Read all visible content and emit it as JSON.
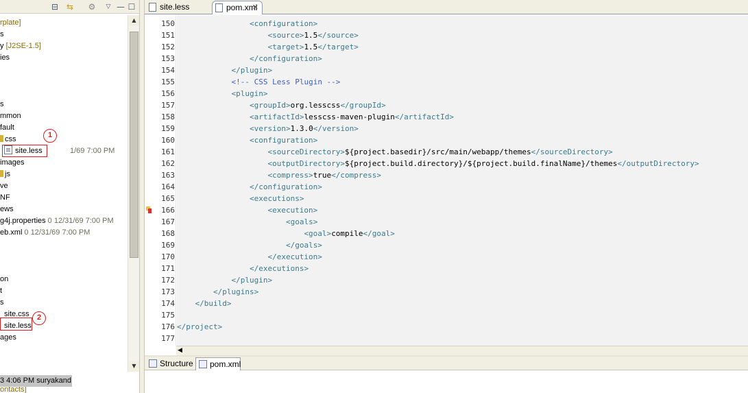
{
  "left_panel": {
    "tree_rows": [
      {
        "text": "rplate]",
        "style": "ann",
        "y": 0
      },
      {
        "text": "s",
        "style": "plain"
      },
      {
        "text": "y ",
        "style": "plain",
        "extra": "[J2SE-1.5]"
      },
      {
        "text": "ies",
        "style": "plain"
      },
      {
        "text": "",
        "style": "plain"
      },
      {
        "text": "",
        "style": "plain"
      },
      {
        "text": "",
        "style": "plain"
      },
      {
        "text": "s",
        "style": "plain"
      },
      {
        "text": "mmon",
        "style": "plain"
      },
      {
        "text": "fault",
        "style": "plain"
      },
      {
        "text": "css",
        "style": "folder"
      },
      {
        "text": "site.less",
        "style": "file",
        "time": "1/69 7:00 PM"
      },
      {
        "text": "images",
        "style": "plain"
      },
      {
        "text": "js",
        "style": "folder"
      },
      {
        "text": "ve",
        "style": "plain"
      },
      {
        "text": "NF",
        "style": "plain"
      },
      {
        "text": "ews",
        "style": "plain"
      },
      {
        "text": "g4j.properties",
        "style": "plain",
        "time": "0  12/31/69 7:00 PM"
      },
      {
        "text": "eb.xml",
        "style": "plain",
        "time": "0  12/31/69 7:00 PM"
      },
      {
        "text": "",
        "style": "plain"
      },
      {
        "text": "",
        "style": "plain"
      },
      {
        "text": "",
        "style": "plain"
      },
      {
        "text": "on",
        "style": "plain"
      },
      {
        "text": "t",
        "style": "plain"
      },
      {
        "text": "s",
        "style": "plain"
      },
      {
        "text": "site.css",
        "style": "plain"
      },
      {
        "text": "site.less",
        "style": "plain"
      },
      {
        "text": "ages",
        "style": "plain"
      }
    ],
    "callouts": [
      "1",
      "2"
    ],
    "status_row": "3 4:06 PM  suryakand",
    "bottom_cut": "ontacts]"
  },
  "editor": {
    "tabs": [
      {
        "label": "site.less",
        "active": false
      },
      {
        "label": "pom.xml",
        "active": true,
        "close": "✕"
      }
    ],
    "lines": [
      {
        "n": "150",
        "indent": 16,
        "parts": [
          [
            "tag",
            "<configuration>"
          ]
        ]
      },
      {
        "n": "151",
        "indent": 20,
        "parts": [
          [
            "tag",
            "<source>"
          ],
          [
            "txt",
            "1.5"
          ],
          [
            "tag",
            "</source>"
          ]
        ]
      },
      {
        "n": "152",
        "indent": 20,
        "parts": [
          [
            "tag",
            "<target>"
          ],
          [
            "txt",
            "1.5"
          ],
          [
            "tag",
            "</target>"
          ]
        ]
      },
      {
        "n": "153",
        "indent": 16,
        "parts": [
          [
            "tag",
            "</configuration>"
          ]
        ]
      },
      {
        "n": "154",
        "indent": 12,
        "parts": [
          [
            "tag",
            "</plugin>"
          ]
        ]
      },
      {
        "n": "155",
        "indent": 12,
        "parts": [
          [
            "cmt",
            "<!-- CSS Less Plugin -->"
          ]
        ]
      },
      {
        "n": "156",
        "indent": 12,
        "parts": [
          [
            "tag",
            "<plugin>"
          ]
        ]
      },
      {
        "n": "157",
        "indent": 16,
        "parts": [
          [
            "tag",
            "<groupId>"
          ],
          [
            "txt",
            "org.lesscss"
          ],
          [
            "tag",
            "</groupId>"
          ]
        ]
      },
      {
        "n": "158",
        "indent": 16,
        "parts": [
          [
            "tag",
            "<artifactId>"
          ],
          [
            "txt",
            "lesscss-maven-plugin"
          ],
          [
            "tag",
            "</artifactId>"
          ]
        ]
      },
      {
        "n": "159",
        "indent": 16,
        "parts": [
          [
            "tag",
            "<version>"
          ],
          [
            "txt",
            "1.3.0"
          ],
          [
            "tag",
            "</version>"
          ]
        ]
      },
      {
        "n": "160",
        "indent": 16,
        "parts": [
          [
            "tag",
            "<configuration>"
          ]
        ]
      },
      {
        "n": "161",
        "indent": 20,
        "parts": [
          [
            "tag",
            "<sourceDirectory>"
          ],
          [
            "txt",
            "${project.basedir}/src/main/webapp/themes"
          ],
          [
            "tag",
            "</sourceDirectory>"
          ]
        ]
      },
      {
        "n": "162",
        "indent": 20,
        "parts": [
          [
            "tag",
            "<outputDirectory>"
          ],
          [
            "txt",
            "${project.build.directory}/${project.build.finalName}/themes"
          ],
          [
            "tag",
            "</outputDirectory>"
          ]
        ]
      },
      {
        "n": "163",
        "indent": 20,
        "parts": [
          [
            "tag",
            "<compress>"
          ],
          [
            "txt",
            "true"
          ],
          [
            "tag",
            "</compress>"
          ]
        ]
      },
      {
        "n": "164",
        "indent": 16,
        "parts": [
          [
            "tag",
            "</configuration>"
          ]
        ]
      },
      {
        "n": "165",
        "indent": 16,
        "parts": [
          [
            "tag",
            "<executions>"
          ]
        ]
      },
      {
        "n": "166",
        "indent": 20,
        "parts": [
          [
            "tag",
            "<execution>"
          ]
        ]
      },
      {
        "n": "167",
        "indent": 24,
        "parts": [
          [
            "tag",
            "<goals>"
          ]
        ]
      },
      {
        "n": "168",
        "indent": 28,
        "parts": [
          [
            "tag",
            "<goal>"
          ],
          [
            "txt",
            "compile"
          ],
          [
            "tag",
            "</goal>"
          ]
        ]
      },
      {
        "n": "169",
        "indent": 24,
        "parts": [
          [
            "tag",
            "</goals>"
          ]
        ]
      },
      {
        "n": "170",
        "indent": 20,
        "parts": [
          [
            "tag",
            "</execution>"
          ]
        ]
      },
      {
        "n": "171",
        "indent": 16,
        "parts": [
          [
            "tag",
            "</executions>"
          ]
        ]
      },
      {
        "n": "172",
        "indent": 12,
        "parts": [
          [
            "tag",
            "</plugin>"
          ]
        ]
      },
      {
        "n": "173",
        "indent": 8,
        "parts": [
          [
            "tag",
            "</plugins>"
          ]
        ]
      },
      {
        "n": "174",
        "indent": 4,
        "parts": [
          [
            "tag",
            "</build>"
          ]
        ]
      },
      {
        "n": "175",
        "indent": 0,
        "parts": []
      },
      {
        "n": "176",
        "indent": 0,
        "parts": [
          [
            "tag",
            "</project>"
          ]
        ]
      },
      {
        "n": "177",
        "indent": 0,
        "parts": []
      }
    ],
    "bottom_tabs": [
      {
        "label": "Structure",
        "active": false
      },
      {
        "label": "pom.xml",
        "active": true
      }
    ]
  }
}
